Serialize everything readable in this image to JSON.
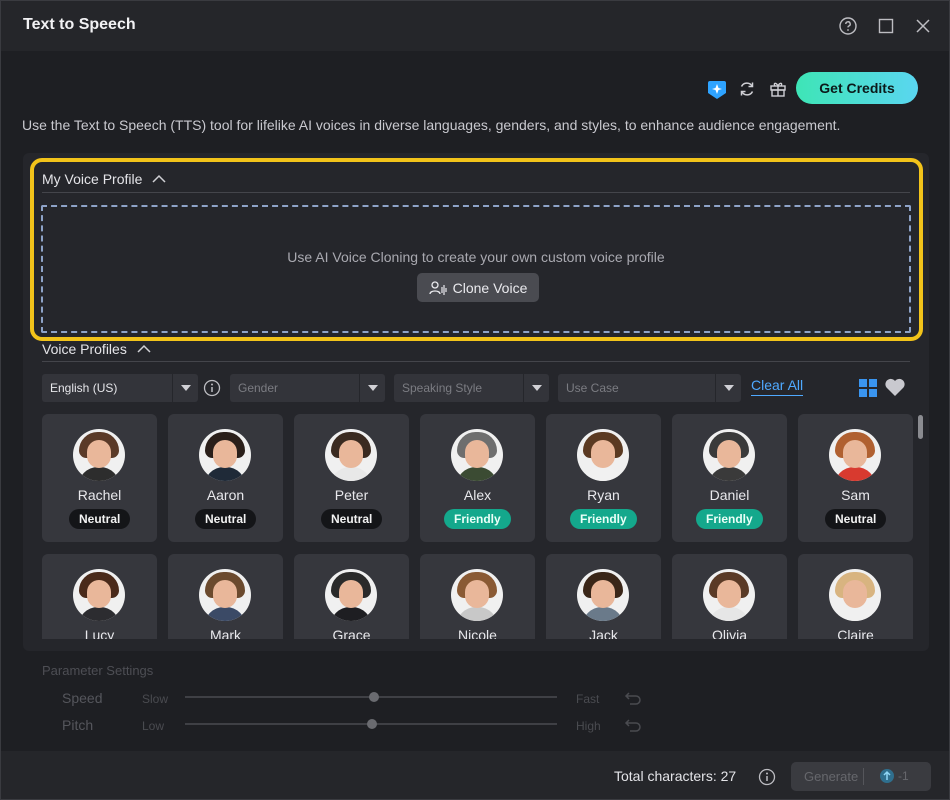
{
  "window": {
    "title": "Text to Speech"
  },
  "toolbar": {
    "get_credits_label": "Get Credits"
  },
  "description": "Use the Text to Speech (TTS) tool for lifelike AI voices in diverse languages, genders, and styles, to enhance audience engagement.",
  "my_voice_profile": {
    "heading": "My Voice Profile",
    "clone_prompt": "Use AI Voice Cloning to create your own custom voice profile",
    "clone_button": "Clone Voice"
  },
  "voice_profiles": {
    "heading": "Voice Profiles",
    "filters": {
      "language": "English (US)",
      "gender_placeholder": "Gender",
      "style_placeholder": "Speaking Style",
      "usecase_placeholder": "Use Case",
      "clear_all": "Clear All"
    },
    "voices": [
      {
        "name": "Rachel",
        "style": "Neutral"
      },
      {
        "name": "Aaron",
        "style": "Neutral"
      },
      {
        "name": "Peter",
        "style": "Neutral"
      },
      {
        "name": "Alex",
        "style": "Friendly"
      },
      {
        "name": "Ryan",
        "style": "Friendly"
      },
      {
        "name": "Daniel",
        "style": "Friendly"
      },
      {
        "name": "Sam",
        "style": "Neutral"
      },
      {
        "name": "Lucy"
      },
      {
        "name": "Mark"
      },
      {
        "name": "Grace"
      },
      {
        "name": "Nicole"
      },
      {
        "name": "Jack"
      },
      {
        "name": "Olivia"
      },
      {
        "name": "Claire"
      }
    ]
  },
  "parameters": {
    "heading": "Parameter Settings",
    "speed": {
      "label": "Speed",
      "min_label": "Slow",
      "max_label": "Fast",
      "value": 0.5
    },
    "pitch": {
      "label": "Pitch",
      "min_label": "Low",
      "max_label": "High",
      "value": 0.5
    }
  },
  "footer": {
    "total_characters": "Total characters: 27",
    "generate_label": "Generate",
    "generate_cost": "-1"
  },
  "colors": {
    "accent": "#3ee5b6",
    "highlight": "#f2c31a",
    "link": "#4fa9ff",
    "friendly_badge": "#14a88c"
  }
}
